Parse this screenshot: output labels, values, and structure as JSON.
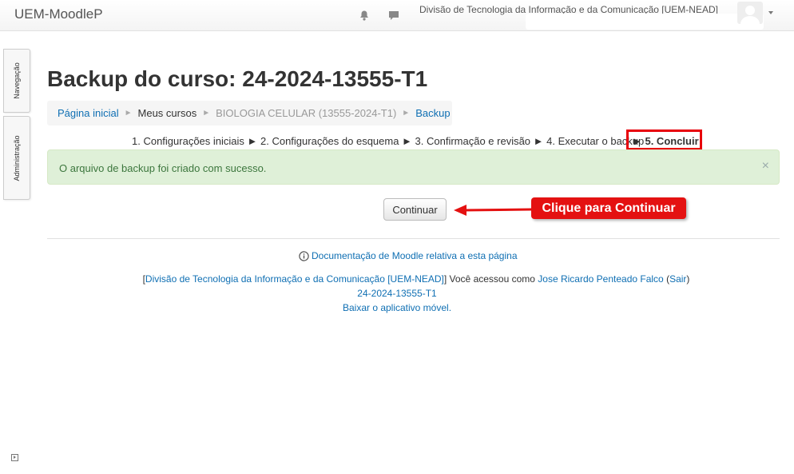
{
  "navbar": {
    "brand": "UEM-MoodleP",
    "user_name": "Divisão de Tecnologia da Informação e da Comunicação [UEM-NEAD]",
    "icons": [
      "notifications-icon",
      "messages-icon",
      "avatar",
      "user-menu-caret"
    ]
  },
  "side_tabs": {
    "navigation": "Navegação",
    "administration": "Administração"
  },
  "page": {
    "title": "Backup do curso: 24-2024-13555-T1"
  },
  "breadcrumb": {
    "home": "Página inicial",
    "my_courses": "Meus cursos",
    "course": "BIOLOGIA CELULAR (13555-2024-T1)",
    "current": "Backup"
  },
  "steps": {
    "list": "1. Configurações iniciais ► 2. Configurações do esquema ► 3. Confirmação e revisão ► 4. Executar o backup",
    "final": "► 5. Concluir"
  },
  "alert": {
    "message": "O arquivo de backup foi criado com sucesso.",
    "close": "×"
  },
  "actions": {
    "continue": "Continuar"
  },
  "annotation": {
    "callout": "Clique para Continuar",
    "accent_color": "#e41111"
  },
  "footer": {
    "doc_link": "Documentação de Moodle relativa a esta página",
    "bracket_open": "[",
    "org_link": "Divisão de Tecnologia da Informação e da Comunicação [UEM-NEAD]",
    "logged_as": "] Você acessou como",
    "user_link": "Jose Ricardo Penteado Falco",
    "logout_open": "(",
    "logout": "Sair",
    "logout_close": ")",
    "course_link": "24-2024-13555-T1",
    "app_link": "Baixar o aplicativo móvel."
  }
}
